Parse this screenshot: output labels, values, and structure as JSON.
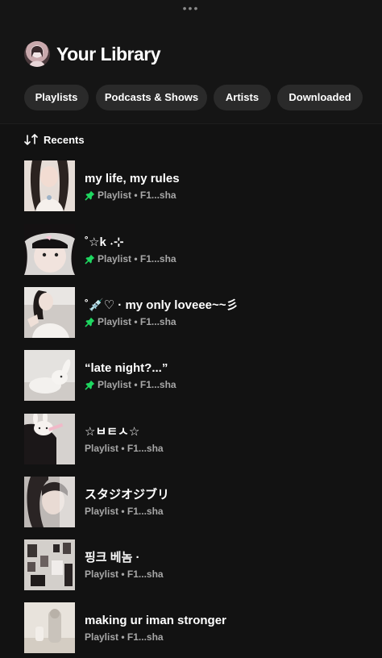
{
  "header": {
    "more_icon": "•••",
    "title": "Your Library",
    "avatar_icon": "profile-avatar"
  },
  "filters": [
    {
      "label": "Playlists"
    },
    {
      "label": "Podcasts & Shows"
    },
    {
      "label": "Artists"
    },
    {
      "label": "Downloaded"
    }
  ],
  "sort": {
    "label": "Recents",
    "icon": "sort-arrows-icon"
  },
  "colors": {
    "accent": "#1ed760",
    "background": "#121212",
    "chip": "#2a2a2a",
    "muted": "#a7a7a7"
  },
  "items": [
    {
      "title": "my life, my rules",
      "subtitle": "Playlist • F1...sha",
      "pinned": true
    },
    {
      "title": "˚☆k ˖⊹",
      "subtitle": "Playlist • F1...sha",
      "pinned": true
    },
    {
      "title": "˚💉♡ · my only loveee~~彡",
      "subtitle": "Playlist • F1...sha",
      "pinned": true
    },
    {
      "title": "“late night?...”",
      "subtitle": "Playlist • F1...sha",
      "pinned": true
    },
    {
      "title": "☆ㅂㅌㅅ☆",
      "subtitle": "Playlist • F1...sha",
      "pinned": false
    },
    {
      "title": "スタジオジブリ",
      "subtitle": "Playlist • F1...sha",
      "pinned": false
    },
    {
      "title": "핑크 베놈 ·",
      "subtitle": "Playlist • F1...sha",
      "pinned": false
    },
    {
      "title": "making ur iman stronger",
      "subtitle": "Playlist • F1...sha",
      "pinned": false
    }
  ]
}
